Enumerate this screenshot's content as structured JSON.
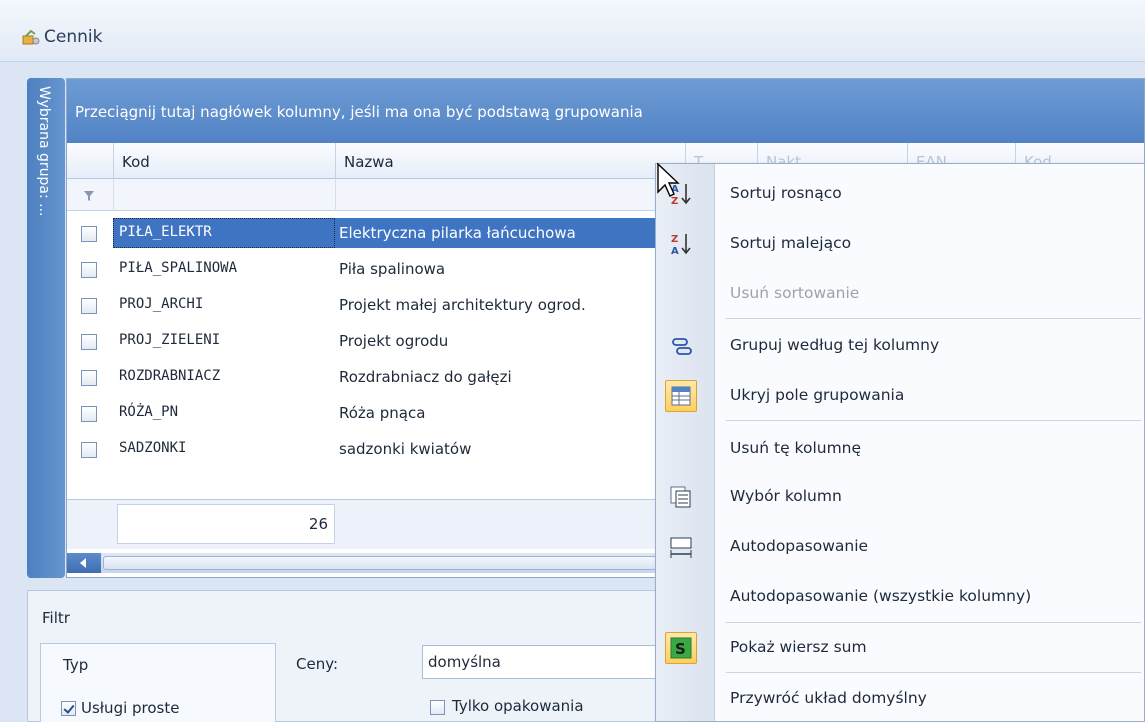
{
  "window": {
    "title": "Cennik"
  },
  "side_tab": {
    "label": "Wybrana grupa: ..."
  },
  "grid": {
    "group_panel_text": "Przeciągnij tutaj nagłówek kolumny, jeśli ma ona być podstawą grupowania",
    "columns": [
      "Kod",
      "Nazwa",
      "T...",
      "Nakt...",
      "EAN...",
      "Kod..."
    ],
    "rows": [
      {
        "kod": "PIŁA_ELEKTR",
        "nazwa": "Elektryczna pilarka łańcuchowa",
        "selected": true
      },
      {
        "kod": "PIŁA_SPALINOWA",
        "nazwa": "Piła spalinowa",
        "selected": false
      },
      {
        "kod": "PROJ_ARCHI",
        "nazwa": "Projekt małej architektury ogrod.",
        "selected": false
      },
      {
        "kod": "PROJ_ZIELENI",
        "nazwa": "Projekt ogrodu",
        "selected": false
      },
      {
        "kod": "ROZDRABNIACZ",
        "nazwa": "Rozdrabniacz do gałęzi",
        "selected": false
      },
      {
        "kod": "RÓŻA_PN",
        "nazwa": "Róża pnąca",
        "selected": false
      },
      {
        "kod": "SADZONKI",
        "nazwa": "sadzonki kwiatów",
        "selected": false
      }
    ],
    "summary_count": "26"
  },
  "filter_panel": {
    "title": "Filtr",
    "typ_label": "Typ",
    "uslugi_proste": "Usługi proste",
    "ceny_label": "Ceny:",
    "ceny_value": "domyślna",
    "tylko_opakowania": "Tylko opakowania"
  },
  "context_menu": {
    "items": [
      {
        "label": "Sortuj rosnąco",
        "icon": "sort-ascending-icon",
        "enabled": true
      },
      {
        "label": "Sortuj malejąco",
        "icon": "sort-descending-icon",
        "enabled": true
      },
      {
        "label": "Usuń sortowanie",
        "icon": "",
        "enabled": false
      },
      {
        "label": "Grupuj według tej kolumny",
        "icon": "group-by-icon",
        "enabled": true
      },
      {
        "label": "Ukryj pole grupowania",
        "icon": "group-panel-icon",
        "enabled": true
      },
      {
        "label": "Usuń tę kolumnę",
        "icon": "",
        "enabled": true
      },
      {
        "label": "Wybór kolumn",
        "icon": "column-chooser-icon",
        "enabled": true
      },
      {
        "label": "Autodopasowanie",
        "icon": "best-fit-icon",
        "enabled": true
      },
      {
        "label": "Autodopasowanie (wszystkie kolumny)",
        "icon": "",
        "enabled": true
      },
      {
        "label": "Pokaż wiersz sum",
        "icon": "sum-icon",
        "enabled": true
      },
      {
        "label": "Przywróć układ domyślny",
        "icon": "",
        "enabled": true
      }
    ]
  },
  "colors": {
    "accent": "#5283c5",
    "selection": "#3f74c2",
    "menu_highlight": "#ffcf5c"
  }
}
